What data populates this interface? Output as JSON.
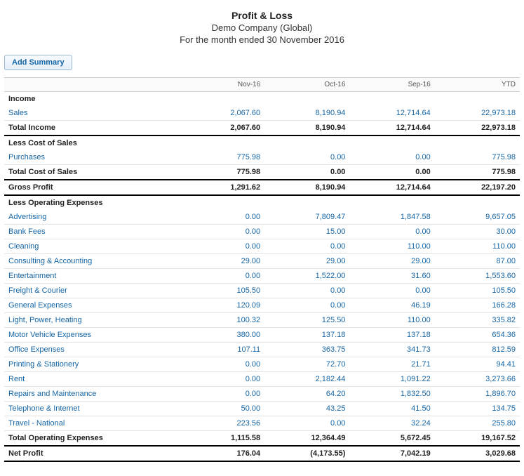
{
  "header": {
    "title": "Profit & Loss",
    "company": "Demo Company (Global)",
    "period": "For the month ended 30 November 2016",
    "add_summary_label": "Add Summary"
  },
  "columns": [
    "Nov-16",
    "Oct-16",
    "Sep-16",
    "YTD"
  ],
  "sections": {
    "income": {
      "title": "Income",
      "rows": [
        {
          "label": "Sales",
          "vals": [
            "2,067.60",
            "8,190.94",
            "12,714.64",
            "22,973.18"
          ]
        }
      ],
      "total": {
        "label": "Total Income",
        "vals": [
          "2,067.60",
          "8,190.94",
          "12,714.64",
          "22,973.18"
        ]
      }
    },
    "cost_of_sales": {
      "title": "Less Cost of Sales",
      "rows": [
        {
          "label": "Purchases",
          "vals": [
            "775.98",
            "0.00",
            "0.00",
            "775.98"
          ]
        }
      ],
      "total": {
        "label": "Total Cost of Sales",
        "vals": [
          "775.98",
          "0.00",
          "0.00",
          "775.98"
        ]
      }
    },
    "gross_profit": {
      "label": "Gross Profit",
      "vals": [
        "1,291.62",
        "8,190.94",
        "12,714.64",
        "22,197.20"
      ]
    },
    "opex": {
      "title": "Less Operating Expenses",
      "rows": [
        {
          "label": "Advertising",
          "vals": [
            "0.00",
            "7,809.47",
            "1,847.58",
            "9,657.05"
          ]
        },
        {
          "label": "Bank Fees",
          "vals": [
            "0.00",
            "15.00",
            "0.00",
            "30.00"
          ]
        },
        {
          "label": "Cleaning",
          "vals": [
            "0.00",
            "0.00",
            "110.00",
            "110.00"
          ]
        },
        {
          "label": "Consulting & Accounting",
          "vals": [
            "29.00",
            "29.00",
            "29.00",
            "87.00"
          ]
        },
        {
          "label": "Entertainment",
          "vals": [
            "0.00",
            "1,522.00",
            "31.60",
            "1,553.60"
          ]
        },
        {
          "label": "Freight & Courier",
          "vals": [
            "105.50",
            "0.00",
            "0.00",
            "105.50"
          ]
        },
        {
          "label": "General Expenses",
          "vals": [
            "120.09",
            "0.00",
            "46.19",
            "166.28"
          ]
        },
        {
          "label": "Light, Power, Heating",
          "vals": [
            "100.32",
            "125.50",
            "110.00",
            "335.82"
          ]
        },
        {
          "label": "Motor Vehicle Expenses",
          "vals": [
            "380.00",
            "137.18",
            "137.18",
            "654.36"
          ]
        },
        {
          "label": "Office Expenses",
          "vals": [
            "107.11",
            "363.75",
            "341.73",
            "812.59"
          ]
        },
        {
          "label": "Printing & Stationery",
          "vals": [
            "0.00",
            "72.70",
            "21.71",
            "94.41"
          ]
        },
        {
          "label": "Rent",
          "vals": [
            "0.00",
            "2,182.44",
            "1,091.22",
            "3,273.66"
          ]
        },
        {
          "label": "Repairs and Maintenance",
          "vals": [
            "0.00",
            "64.20",
            "1,832.50",
            "1,896.70"
          ]
        },
        {
          "label": "Telephone & Internet",
          "vals": [
            "50.00",
            "43.25",
            "41.50",
            "134.75"
          ]
        },
        {
          "label": "Travel - National",
          "vals": [
            "223.56",
            "0.00",
            "32.24",
            "255.80"
          ]
        }
      ],
      "total": {
        "label": "Total Operating Expenses",
        "vals": [
          "1,115.58",
          "12,364.49",
          "5,672.45",
          "19,167.52"
        ]
      }
    },
    "net_profit": {
      "label": "Net Profit",
      "vals": [
        "176.04",
        "(4,173.55)",
        "7,042.19",
        "3,029.68"
      ]
    }
  }
}
